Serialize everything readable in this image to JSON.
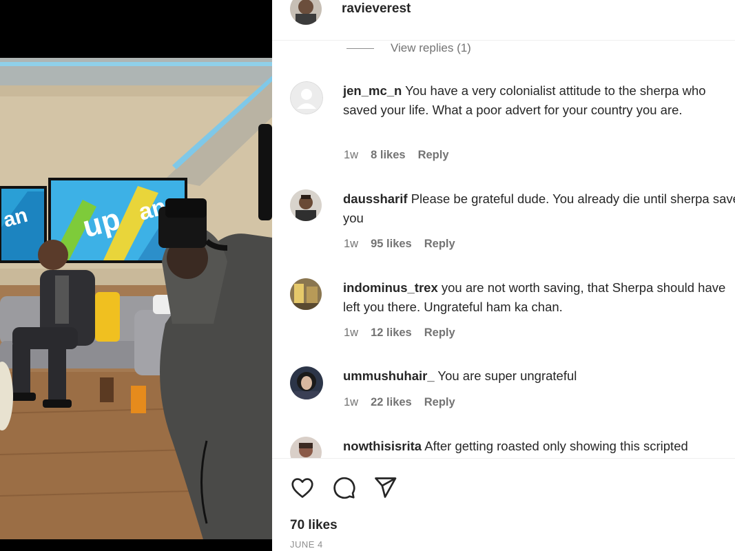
{
  "post": {
    "username": "ravieverest",
    "likes_label": "70 likes",
    "date_label": "JUNE 4"
  },
  "view_replies": "View replies (1)",
  "comments": [
    {
      "username": "jen_mc_n",
      "text": "You have a very colonialist attitude to the sherpa who saved your life. What a poor advert for your country you are.",
      "time": "1w",
      "likes": "8 likes",
      "reply": "Reply",
      "avatar": "default-avatar"
    },
    {
      "username": "daussharif",
      "text": "Please be grateful dude. You already die until sherpa save you",
      "time": "1w",
      "likes": "95 likes",
      "reply": "Reply",
      "avatar": "photo-avatar"
    },
    {
      "username": "indominus_trex",
      "text": "you are not worth saving, that Sherpa should have left you there. Ungrateful ham ka chan.",
      "time": "1w",
      "likes": "12 likes",
      "reply": "Reply",
      "avatar": "photo-avatar"
    },
    {
      "username": "ummushuhair_",
      "text": "You are super ungrateful",
      "time": "1w",
      "likes": "22 likes",
      "reply": "Reply",
      "avatar": "photo-avatar"
    },
    {
      "username": "nowthisisrita",
      "text": "After getting roasted only showing this scripted",
      "time": "",
      "likes": "",
      "reply": "",
      "avatar": "photo-avatar"
    }
  ],
  "icons": {
    "like": "heart-icon",
    "comment": "comment-bubble-icon",
    "share": "send-paper-plane-icon"
  },
  "colors": {
    "text": "#262626",
    "secondary": "#737373",
    "divider": "#efefef"
  }
}
